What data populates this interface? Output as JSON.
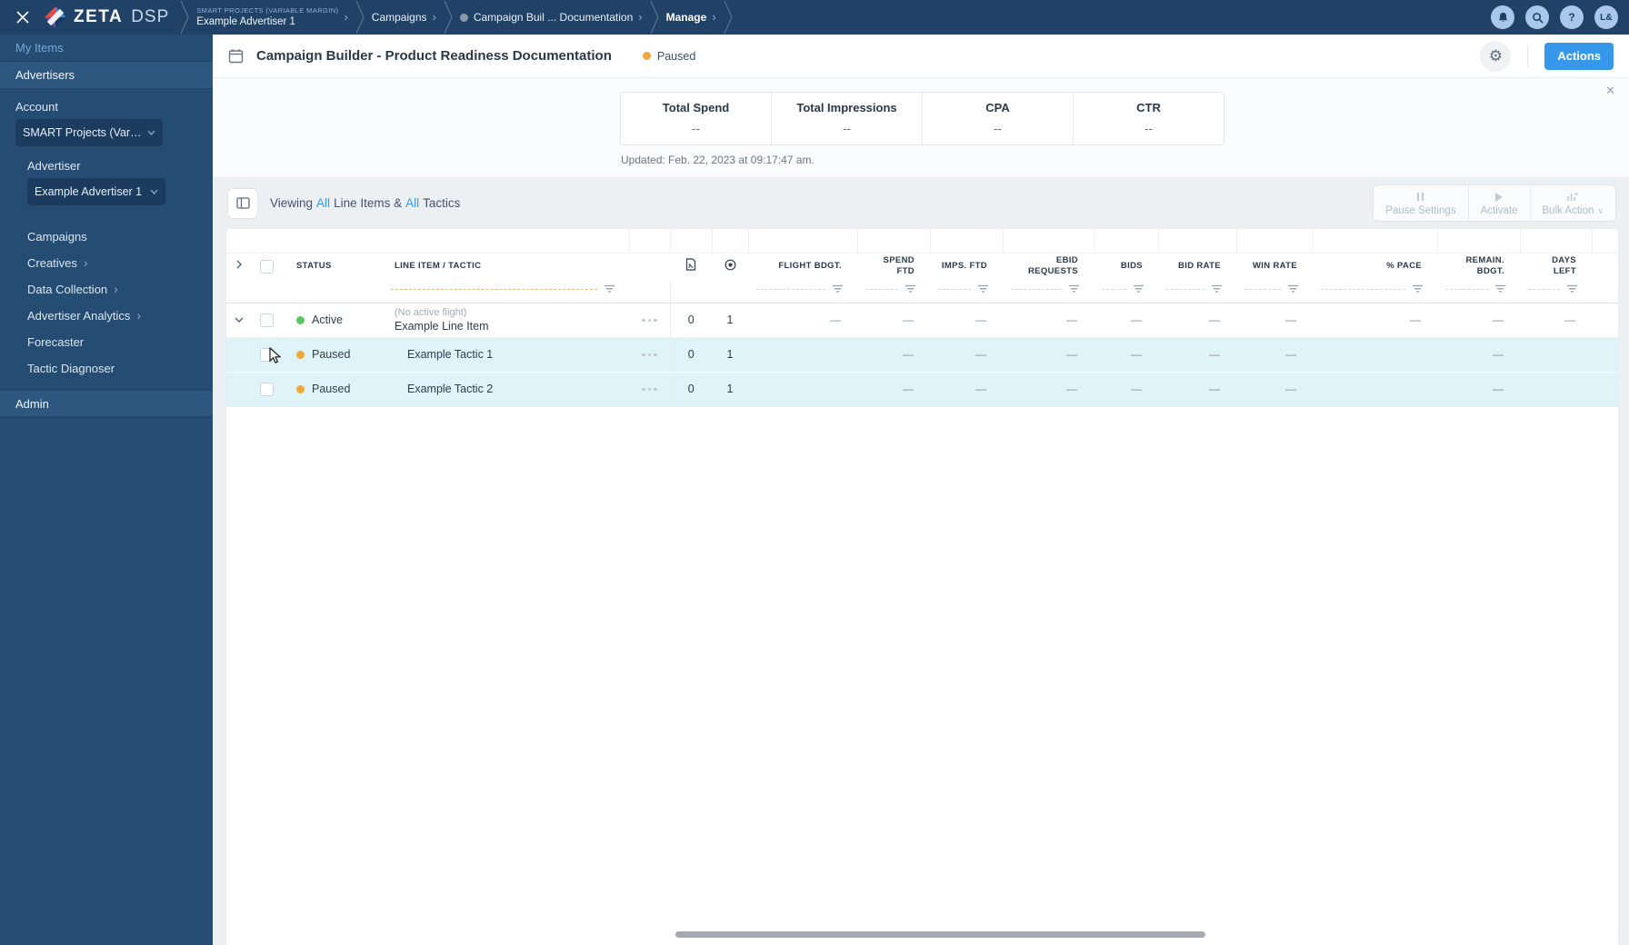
{
  "topbar": {
    "logo_zeta": "ZETA",
    "logo_dsp": "DSP",
    "breadcrumbs": [
      {
        "eyebrow": "SMART PROJECTS (VARIABLE MARGIN)",
        "label": "Example Advertiser 1"
      },
      {
        "label": "Campaigns"
      },
      {
        "label": "Campaign Buil ... Documentation"
      },
      {
        "label": "Manage"
      }
    ],
    "avatar": "L&"
  },
  "sidebar": {
    "my_items": "My Items",
    "advertisers": "Advertisers",
    "account_label": "Account",
    "account_value": "SMART Projects (Variable M...",
    "advertiser_label": "Advertiser",
    "advertiser_value": "Example Advertiser 1",
    "nav": [
      {
        "label": "Campaigns"
      },
      {
        "label": "Creatives"
      },
      {
        "label": "Data Collection"
      },
      {
        "label": "Advertiser Analytics"
      },
      {
        "label": "Forecaster"
      },
      {
        "label": "Tactic Diagnoser"
      }
    ],
    "admin": "Admin"
  },
  "header": {
    "title": "Campaign Builder - Product Readiness Documentation",
    "status": "Paused",
    "actions": "Actions"
  },
  "stats": {
    "cards": [
      {
        "label": "Total Spend",
        "value": "--"
      },
      {
        "label": "Total Impressions",
        "value": "--"
      },
      {
        "label": "CPA",
        "value": "--"
      },
      {
        "label": "CTR",
        "value": "--"
      }
    ],
    "updated": "Updated: Feb. 22, 2023 at 09:17:47 am."
  },
  "toolbar": {
    "v_prefix": "Viewing",
    "v_all1": "All",
    "v_mid": "Line Items &",
    "v_all2": "All",
    "v_suffix": "Tactics",
    "buttons": [
      {
        "label": "Pause Settings"
      },
      {
        "label": "Activate"
      },
      {
        "label": "Bulk Action"
      }
    ]
  },
  "table": {
    "columns": [
      "STATUS",
      "LINE ITEM / TACTIC",
      "FLIGHT BDGT.",
      "SPEND FTD",
      "IMPS. FTD",
      "EBID REQUESTS",
      "BIDS",
      "BID RATE",
      "WIN RATE",
      "% PACE",
      "REMAIN. BDGT.",
      "DAYS LEFT"
    ],
    "rows": [
      {
        "type": "line-item",
        "status": "Active",
        "note": "(No active flight)",
        "name": "Example Line Item",
        "creatives": "0",
        "targets": "1",
        "cells": {
          "flight": "—",
          "spend": "—",
          "imps": "—",
          "ebid": "—",
          "bids": "—",
          "bid_rate": "—",
          "win_rate": "—",
          "pace": "—",
          "remain": "—",
          "days": "—"
        }
      },
      {
        "type": "tactic",
        "status": "Paused",
        "name": "Example Tactic 1",
        "creatives": "0",
        "targets": "1",
        "cells": {
          "flight": "",
          "spend": "—",
          "imps": "—",
          "ebid": "—",
          "bids": "—",
          "bid_rate": "—",
          "win_rate": "—",
          "pace": "",
          "remain": "—",
          "days": ""
        }
      },
      {
        "type": "tactic",
        "status": "Paused",
        "name": "Example Tactic 2",
        "creatives": "0",
        "targets": "1",
        "cells": {
          "flight": "",
          "spend": "—",
          "imps": "—",
          "ebid": "—",
          "bids": "—",
          "bid_rate": "—",
          "win_rate": "—",
          "pace": "",
          "remain": "—",
          "days": ""
        }
      }
    ]
  },
  "colors": {
    "topbar_navy": "#1f4266",
    "sidebar_navy": "#254d74",
    "accent_blue": "#3598ea",
    "status_paused": "#f0a83f",
    "status_active": "#5bc564",
    "row_highlight": "#dff4f9"
  }
}
